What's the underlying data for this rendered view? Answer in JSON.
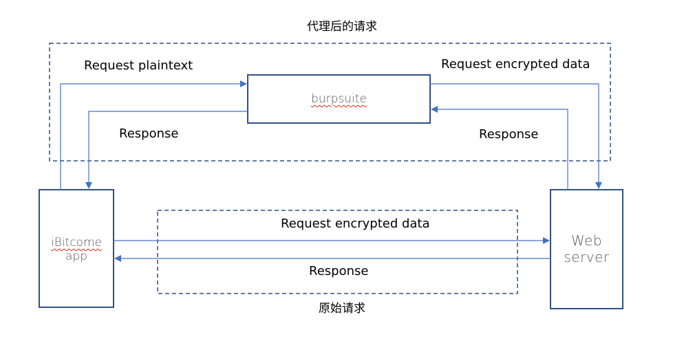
{
  "regions": {
    "proxied": {
      "title": "代理后的请求"
    },
    "original": {
      "title": "原始请求"
    }
  },
  "nodes": {
    "burpsuite": {
      "label": "burpsuite"
    },
    "app": {
      "line1": "iBitcome",
      "line2": "app"
    },
    "server": {
      "line1": "Web",
      "line2": "server"
    }
  },
  "edges": {
    "proxy_request_in": {
      "label": "Request plaintext"
    },
    "proxy_response_out": {
      "label": "Response"
    },
    "proxy_request_out": {
      "label": "Request encrypted data"
    },
    "proxy_response_in": {
      "label": "Response"
    },
    "direct_request": {
      "label": "Request encrypted data"
    },
    "direct_response": {
      "label": "Response"
    }
  },
  "colors": {
    "box_stroke": "#2f4f86",
    "arrow": "#4472c4",
    "node_text": "#595959",
    "spellcheck": "#d9281e"
  }
}
